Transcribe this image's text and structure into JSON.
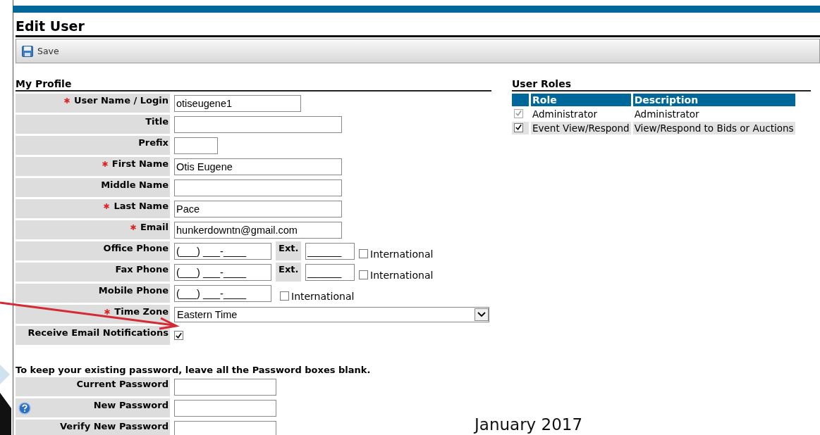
{
  "page": {
    "title": "Edit User"
  },
  "toolbar": {
    "save_label": "Save"
  },
  "profile": {
    "heading": "My Profile",
    "fields": [
      {
        "kind": "text",
        "label": "User Name / Login",
        "required": true,
        "value": "otiseugene1"
      },
      {
        "kind": "text",
        "label": "Title",
        "required": false
      },
      {
        "kind": "text",
        "label": "Prefix",
        "required": false
      },
      {
        "kind": "text",
        "label": "First Name",
        "required": true,
        "value": "Otis Eugene"
      },
      {
        "kind": "text",
        "label": "Middle Name",
        "required": false
      },
      {
        "kind": "text",
        "label": "Last Name",
        "required": true,
        "value": "Pace"
      },
      {
        "kind": "text",
        "label": "Email",
        "required": true,
        "value": "hunkerdowntn@gmail.com"
      },
      {
        "kind": "phone",
        "label": "Office Phone",
        "required": false,
        "value": "(___) ___-____",
        "ext_label": "Ext.",
        "ext_value": "______",
        "international_label": "International",
        "international_checked": false
      },
      {
        "kind": "phone",
        "label": "Fax Phone",
        "required": false,
        "value": "(___) ___-____",
        "ext_label": "Ext.",
        "ext_value": "______",
        "international_label": "International",
        "international_checked": false
      },
      {
        "kind": "phone",
        "label": "Mobile Phone",
        "required": false,
        "value": "(___) ___-____",
        "international_label": "International",
        "international_checked": false
      },
      {
        "kind": "select",
        "label": "Time Zone",
        "required": true,
        "value": "Eastern Time"
      },
      {
        "kind": "checkbox",
        "label": "Receive Email Notifications",
        "required": false,
        "checked": true
      }
    ]
  },
  "password": {
    "note": "To keep your existing password, leave all the Password boxes blank.",
    "fields": [
      {
        "label": "Current Password",
        "help": false
      },
      {
        "label": "New Password",
        "help": true
      },
      {
        "label": "Verify New Password",
        "help": false
      }
    ]
  },
  "roles": {
    "heading": "User Roles",
    "columns": [
      "Role",
      "Description"
    ],
    "rows": [
      {
        "role": "Administrator",
        "description": "Administrator",
        "checked": true,
        "disabled": true
      },
      {
        "role": "Event View/Respond",
        "description": "View/Respond to Bids or Auctions",
        "checked": true,
        "disabled": false
      }
    ]
  },
  "slide_footer": "January 2017"
}
